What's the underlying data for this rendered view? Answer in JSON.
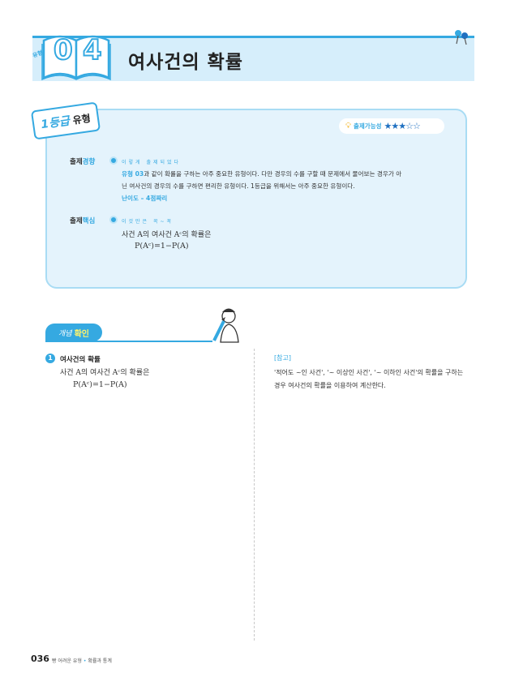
{
  "header": {
    "type_tag": "유형",
    "number_digit1": "0",
    "number_digit2": "4",
    "title": "여사건의 확률"
  },
  "info_box": {
    "grade_tag_prefix": "1등급",
    "grade_tag_label": "유형",
    "probability_label": "출제가능성",
    "probability_stars": "★★★☆☆",
    "trend": {
      "label_a": "출제",
      "label_b": "경향",
      "subtitle": "이렇게 출제되었다",
      "type_ref": "유형 03",
      "text_1": "과 같이 확률을 구하는 아주 중요한 유형이다. 다만 경우의 수를 구할 때 문제에서 물어보는 경우가 아",
      "text_2": "닌 여사건의 경우의 수를 구하면 편리한 유형이다. 1등급을 위해서는 아주 중요한 유형이다.",
      "difficulty": "난이도 – 4점짜리"
    },
    "core": {
      "label_a": "출제",
      "label_b": "핵심",
      "subtitle": "이것만은 꼭~꼭",
      "line": "사건 A의 여사건 Aᶜ의 확률은",
      "formula": "P(Aᶜ)=1−P(A)"
    }
  },
  "concept": {
    "tag_a": "개념",
    "tag_b": "확인",
    "item_number": "1",
    "item_title": "여사건의 확률",
    "item_line": "사건 A의 여사건 Aᶜ의 확률은",
    "item_formula": "P(Aᶜ)=1−P(A)",
    "ref_label": "[참고]",
    "ref_text": "'적어도 ~인 사건', '~ 이상인 사건', '~ 이하인 사건'의 확률을 구하는 경우 여사건의 확률을 이용하여 계산한다."
  },
  "footer": {
    "page_number": "036",
    "book_title": "빵 어려운 유형",
    "section": "확률과 통계"
  }
}
